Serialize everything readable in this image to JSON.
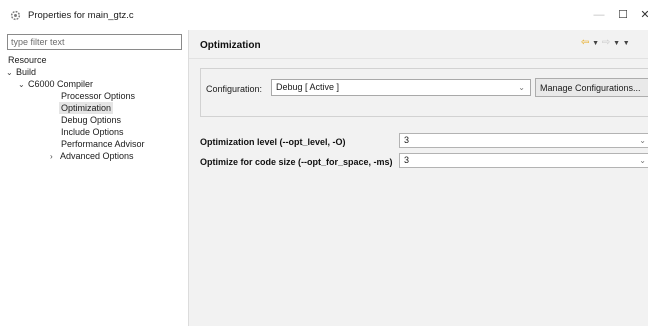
{
  "window": {
    "title": "Properties for main_gtz.c",
    "app_icon": "gear-icon",
    "controls": {
      "minimize": "—",
      "maximize": "☐",
      "close": "✕"
    }
  },
  "filter": {
    "placeholder": "type filter text",
    "value": ""
  },
  "tree": {
    "items": [
      {
        "label": "Resource",
        "chevron": ""
      },
      {
        "label": "Build",
        "chevron": "⌄"
      },
      {
        "label": "C6000 Compiler",
        "chevron": "⌄"
      },
      {
        "label": "Processor Options",
        "chevron": ""
      },
      {
        "label": "Optimization",
        "chevron": "",
        "selected": true
      },
      {
        "label": "Debug Options",
        "chevron": ""
      },
      {
        "label": "Include Options",
        "chevron": ""
      },
      {
        "label": "Performance Advisor",
        "chevron": ""
      },
      {
        "label": "Advanced Options",
        "chevron": "›"
      }
    ]
  },
  "page": {
    "title": "Optimization",
    "nav": {
      "back_icon": "back-arrow-icon",
      "forward_icon": "forward-arrow-icon",
      "menu_icon": "chevron-down-icon"
    }
  },
  "configuration": {
    "label": "Configuration:",
    "selected": "Debug  [ Active ]",
    "manage_label": "Manage Configurations..."
  },
  "options": [
    {
      "label": "Optimization level (--opt_level, -O)",
      "value": "3"
    },
    {
      "label": "Optimize for code size (--opt_for_space, -ms)",
      "value": "3"
    }
  ],
  "colors": {
    "accent_back_arrow": "#e8a91a",
    "selected_bg": "#e5e5e5",
    "panel_bg": "#f2f2f2"
  }
}
